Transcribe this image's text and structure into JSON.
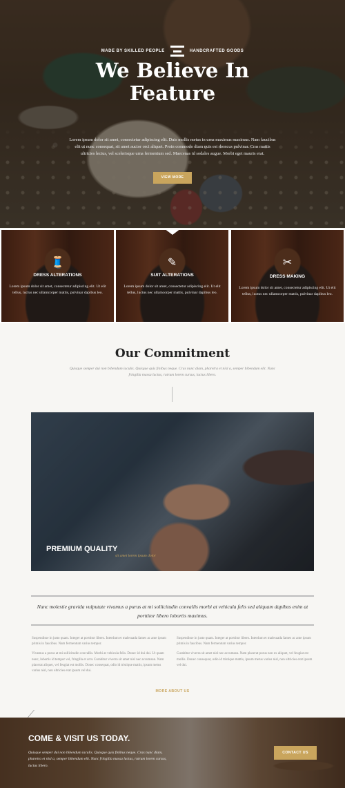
{
  "hero": {
    "tagline_left": "MADE BY SKILLED PEOPLE",
    "tagline_right": "HANDCRAFTED GOODS",
    "title_line1": "We Believe In",
    "title_line2": "Feature",
    "text": "Lorem ipsum dolor sit amet, consectetur adipiscing elit. Duis mollis metus in urna maximus maximus. Nam faucibus elit ut nunc consequat, sit amet auctor orci aliquet. Proin commodo diam quis est rhoncus pulvinar. Cras mattis ultricies lectus, vel scelerisque urna fermentum sed. Maecenas id sodales augue. Morbi eget mauris erat.",
    "button": "VIEW MORE"
  },
  "services": [
    {
      "icon": "spool-icon",
      "glyph": "🧵",
      "title": "DRESS ALTERATIONS",
      "text": "Lorem ipsum dolor sit amet, consectetur adipiscing elit. Ut elit tellus, luctus nec ullamcorper mattis, pulvinar dapibus leo."
    },
    {
      "icon": "needle-icon",
      "glyph": "✎",
      "title": "SUIT ALTERATIONS",
      "text": "Lorem ipsum dolor sit amet, consectetur adipiscing elit. Ut elit tellus, luctus nec ullamcorper mattis, pulvinar dapibus leo."
    },
    {
      "icon": "scissors-icon",
      "glyph": "✂",
      "title": "DRESS MAKING",
      "text": "Lorem ipsum dolor sit amet, consectetur adipiscing elit. Ut elit tellus, luctus nec ullamcorper mattis, pulvinar dapibus leo."
    }
  ],
  "commitment": {
    "title": "Our Commitment",
    "subtitle": "Quisque semper dui non bibendum iaculis. Quisque quis finibus neque. Cras nunc diam, pharetra et nisl a, semper bibendum elit. Nunc fringilla massa luctus, rutrum lorem cursus, luctus libero."
  },
  "feature": {
    "label": "PREMIUM QUALITY",
    "sub": "sit amet lorem ipsum dolor"
  },
  "quote": "Nunc molestie gravida vulputate vivamus a purus at mi sollicitudin convallis morbi at vehicula felis sed aliquam dapibus enim at porttitor libero lobortis maximus.",
  "columns": {
    "left": [
      "Suspendisse in justo quam. Integer at porttitor libero. Interdum et malesuada fames ac ante ipsum primis in faucibus. Nam fermentum varius tempor.",
      "Vivamus a purus at mi sollicitudin convallis. Morbi at vehicula felis. Donec id dui dui. Ut quam nunc, lobortis id tempor vel, fringilla et arcu Curabitur viverra sit amet nisl nec accumsan. Nam placerat aliquet, vel feugiat est mollis. Donec consequat, odio id tristique mattis, ipsum metus varius nisl, non ultricies erat ipsum vel dui."
    ],
    "right": [
      "Suspendisse in justo quam. Integer at porttitor libero. Interdum et malesuada fames ac ante ipsum primis in faucibus. Nam fermentum varius tempor.",
      "Curabitur viverra sit amet nisl nec accumsan. Nam placerat purus non ex aliquet, vel feugiat est mollis. Donec consequat, odio id tristique mattis, ipsum metus varius nisl, non ultricies erat ipsum vel dui."
    ]
  },
  "more_link": "MORE ABOUT US",
  "visit": {
    "title": "COME & VISIT US TODAY.",
    "text": "Quisque semper dui non bibendum iaculis. Quisque quis finibus neque. Cras nunc diam, pharetra et nisl a, semper bibendum elit. Nunc fringilla massa luctus, rutrum lorem cursus, luctus libero.",
    "button": "CONTACT US"
  },
  "colors": {
    "accent": "#c9a55d",
    "background": "#f7f6f3",
    "heading": "#222222"
  }
}
